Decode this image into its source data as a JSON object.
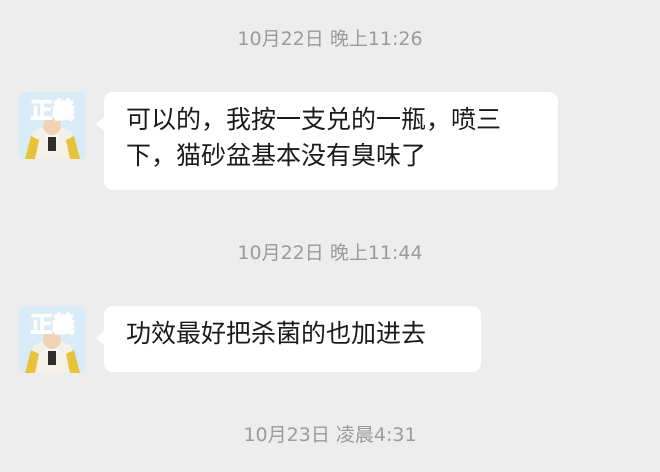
{
  "chat": {
    "messages": [
      {
        "timestamp": "10月22日 晚上11:26",
        "avatar_text": "正義",
        "text": "可以的，我按一支兑的一瓶，喷三下，猫砂盆基本没有臭味了"
      },
      {
        "timestamp": "10月22日 晚上11:44",
        "avatar_text": "正義",
        "text": "功效最好把杀菌的也加进去"
      }
    ],
    "trailing_timestamp": "10月23日 凌晨4:31"
  },
  "colors": {
    "background": "#ededed",
    "bubble": "#ffffff",
    "timestamp": "#9b9b9b",
    "text": "#1a1a1a",
    "avatar_glyph": "#d0271f"
  }
}
